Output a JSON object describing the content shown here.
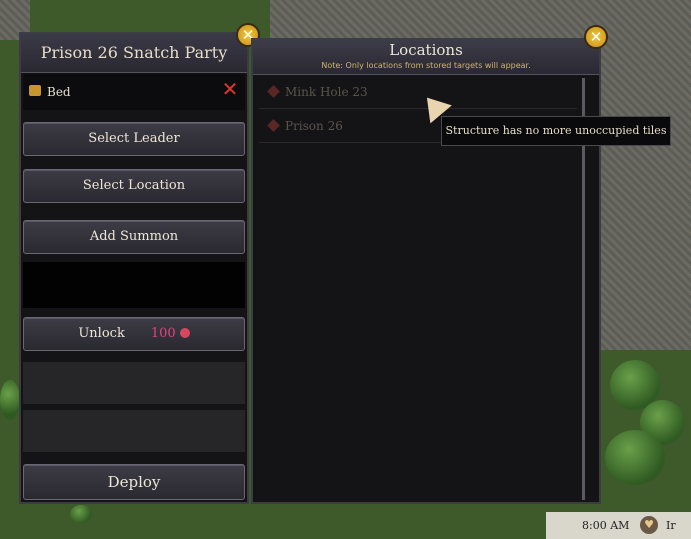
{
  "left_panel": {
    "title": "Prison 26 Snatch Party",
    "item": {
      "label": "Bed",
      "remove": "✕"
    },
    "buttons": {
      "select_leader": "Select Leader",
      "select_location": "Select Location",
      "add_summon": "Add Summon",
      "unlock": "Unlock",
      "unlock_cost": "100",
      "deploy": "Deploy"
    },
    "close": "✕"
  },
  "right_panel": {
    "title": "Locations",
    "note": "Note: Only locations from stored targets will appear.",
    "locations": [
      {
        "name": "Mink Hole 23"
      },
      {
        "name": "Prison 26"
      }
    ],
    "close": "✕"
  },
  "tooltip": {
    "text": "Structure has no more unoccupied tiles"
  },
  "hud": {
    "time": "8:00 AM",
    "rest": "Ir"
  },
  "colors": {
    "accent": "#f0c73a",
    "remove": "#e0342a",
    "cost": "#e0457a",
    "note": "#d1b46a"
  }
}
